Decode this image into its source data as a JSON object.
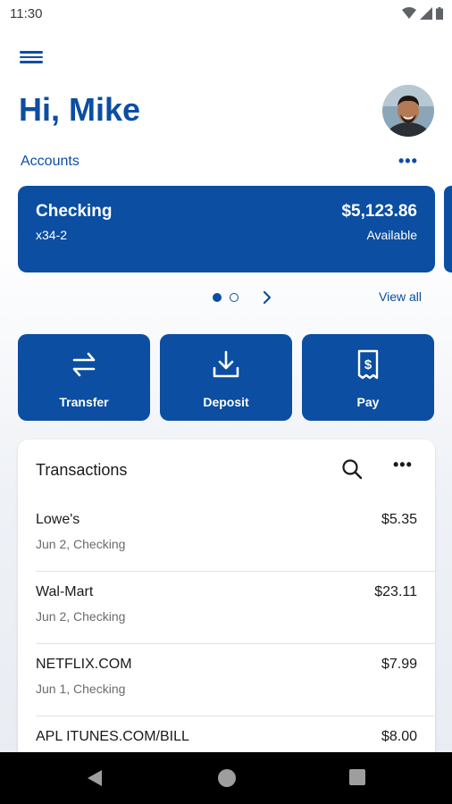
{
  "status_bar": {
    "time": "11:30"
  },
  "header": {
    "greeting": "Hi, Mike"
  },
  "accounts": {
    "label": "Accounts",
    "more_label": "•••",
    "cards": [
      {
        "name": "Checking",
        "number": "x34-2",
        "balance": "$5,123.86",
        "balance_label": "Available"
      }
    ],
    "view_all_label": "View all"
  },
  "actions": [
    {
      "label": "Transfer",
      "icon": "transfer-icon"
    },
    {
      "label": "Deposit",
      "icon": "deposit-icon"
    },
    {
      "label": "Pay",
      "icon": "pay-icon"
    }
  ],
  "transactions": {
    "title": "Transactions",
    "more_label": "•••",
    "items": [
      {
        "merchant": "Lowe's",
        "meta": "Jun 2, Checking",
        "amount": "$5.35"
      },
      {
        "merchant": "Wal-Mart",
        "meta": "Jun 2, Checking",
        "amount": "$23.11"
      },
      {
        "merchant": "NETFLIX.COM",
        "meta": "Jun 1, Checking",
        "amount": "$7.99"
      },
      {
        "merchant": "APL ITUNES.COM/BILL",
        "meta": "",
        "amount": "$8.00"
      }
    ]
  },
  "colors": {
    "brand": "#0b4ea2",
    "nav": "#000000"
  }
}
